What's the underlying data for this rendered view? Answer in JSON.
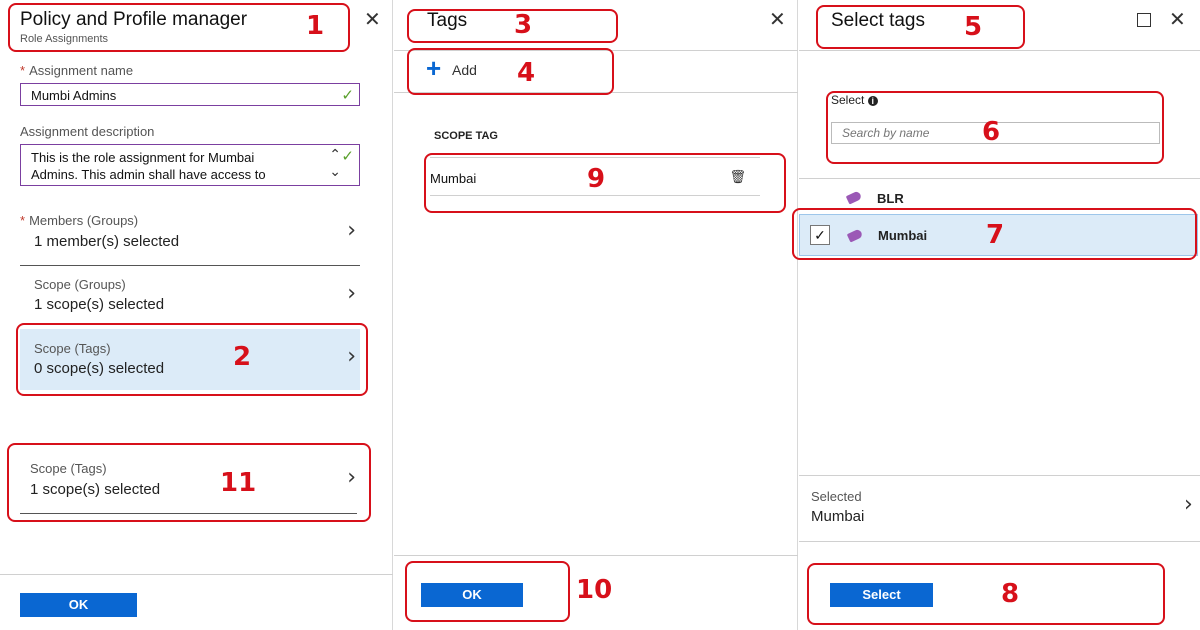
{
  "policy_panel": {
    "title": "Policy and Profile manager",
    "subtitle": "Role Assignments",
    "assignment_name_label": "Assignment name",
    "assignment_name_value": "Mumbi Admins",
    "assignment_description_label": "Assignment description",
    "assignment_description_line1": "This is the role assignment for Mumbai",
    "assignment_description_line2": "Admins. This admin shall have access to",
    "members_label": "Members (Groups)",
    "members_value": "1 member(s) selected",
    "scope_groups_label": "Scope (Groups)",
    "scope_groups_value": "1 scope(s) selected",
    "scope_tags_label": "Scope (Tags)",
    "scope_tags_value": "0 scope(s) selected",
    "scope_tags_after_label": "Scope (Tags)",
    "scope_tags_after_value": "1 scope(s) selected",
    "ok_label": "OK"
  },
  "tags_panel": {
    "title": "Tags",
    "add_label": "Add",
    "column_header": "SCOPE TAG",
    "rows": [
      "Mumbai"
    ],
    "ok_label": "OK"
  },
  "select_tags_panel": {
    "title": "Select tags",
    "select_label": "Select",
    "search_placeholder": "Search by name",
    "items": [
      {
        "name": "BLR",
        "selected": false
      },
      {
        "name": "Mumbai",
        "selected": true
      }
    ],
    "selected_label": "Selected",
    "selected_value": "Mumbai",
    "select_button_label": "Select"
  },
  "annotations": [
    "1",
    "2",
    "3",
    "4",
    "5",
    "6",
    "7",
    "8",
    "9",
    "10",
    "11"
  ],
  "colors": {
    "accent_blue": "#0a67d2",
    "annotation_red": "#d7101a",
    "selected_row_bg": "#dcebf8",
    "field_border": "#7b3fa0",
    "tag_purple": "#9b59b6",
    "valid_check": "#5aa02c"
  }
}
